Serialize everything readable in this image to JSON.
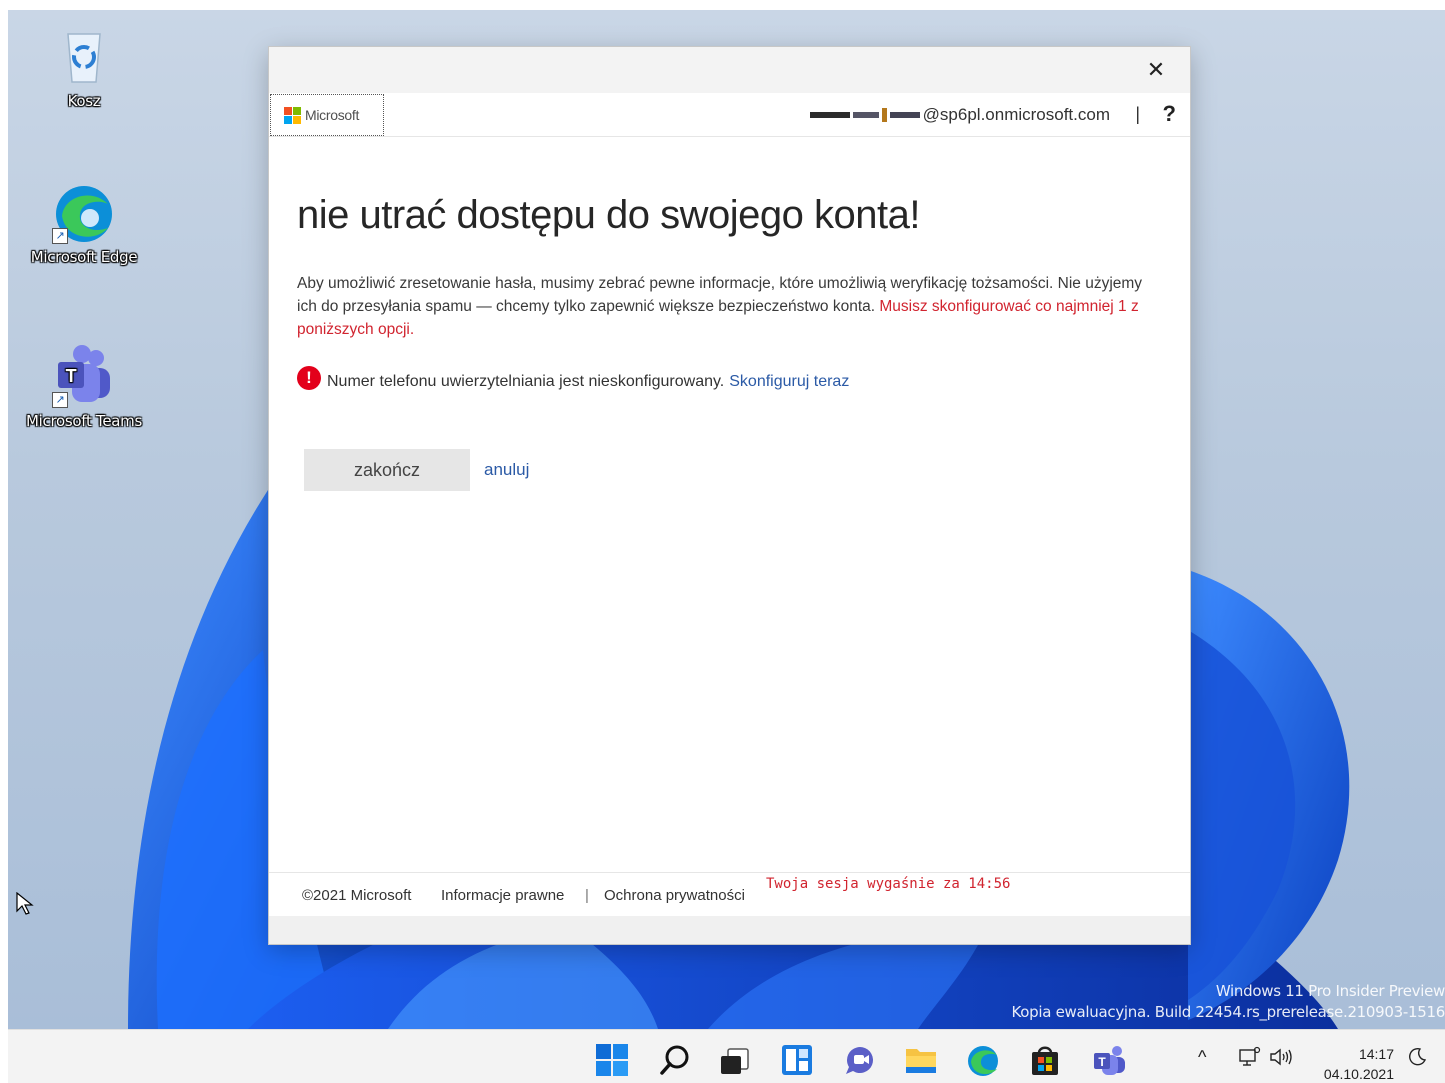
{
  "desktop": {
    "icons": [
      {
        "label": "Kosz",
        "icon": "recycle-bin-icon"
      },
      {
        "label": "Microsoft Edge",
        "icon": "edge-icon"
      },
      {
        "label": "Microsoft Teams",
        "icon": "teams-icon"
      }
    ],
    "watermark": {
      "line1": "Windows 11 Pro Insider Preview",
      "line2": "Kopia ewaluacyjna. Build 22454.rs_prerelease.210903-1516"
    }
  },
  "window": {
    "close_label": "✕",
    "header": {
      "logo_text": "Microsoft",
      "account_suffix": "@sp6pl.onmicrosoft.com",
      "separator": "|",
      "help_label": "?"
    },
    "title": "nie utrać dostępu do swojego konta!",
    "description": "Aby umożliwić zresetowanie hasła, musimy zebrać pewne informacje, które umożliwią weryfikację tożsamości. Nie użyjemy ich do przesyłania spamu — chcemy tylko zapewnić większe bezpieczeństwo konta.",
    "description_warning": "Musisz skonfigurować co najmniej 1 z poniższych opcji.",
    "status": {
      "icon": "alert-icon",
      "text": "Numer telefonu uwierzytelniania jest nieskonfigurowany.",
      "link": "Skonfiguruj teraz"
    },
    "actions": {
      "finish_label": "zakończ",
      "cancel_label": "anuluj"
    },
    "footer": {
      "copyright": "©2021 Microsoft",
      "legal": "Informacje prawne",
      "divider": "|",
      "privacy": "Ochrona prywatności",
      "session": "Twoja sesja wygaśnie za 14:56"
    }
  },
  "taskbar": {
    "items": [
      "start-icon",
      "search-icon",
      "task-view-icon",
      "widgets-icon",
      "chat-icon",
      "file-explorer-icon",
      "edge-icon",
      "store-icon",
      "teams-icon"
    ],
    "tray": {
      "chevron": "^",
      "time": "14:17",
      "date": "04.10.2021"
    }
  },
  "colors": {
    "accent_link": "#2b5aa6",
    "warning_red": "#d1242f",
    "alert_red": "#e3001b"
  }
}
